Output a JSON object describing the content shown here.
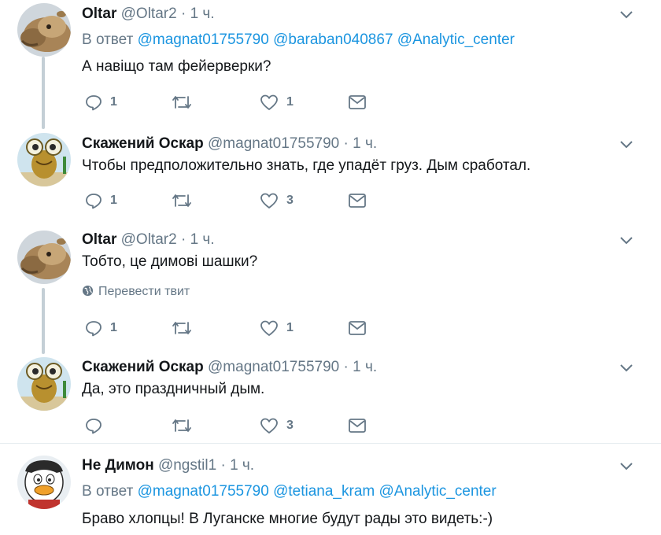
{
  "tweets": [
    {
      "name": "Oltar",
      "handle": "@Oltar2",
      "dot": "·",
      "time": "1 ч.",
      "reply_prefix": "В ответ",
      "mentions": [
        "@magnat01755790",
        "@baraban040867",
        "@Analytic_center"
      ],
      "text": "А навіщо там фейерверки?",
      "replies": "1",
      "retweets": "",
      "likes": "1"
    },
    {
      "name": "Скажений Оскар",
      "handle": "@magnat01755790",
      "dot": "·",
      "time": "1 ч.",
      "text": "Чтобы предположительно знать, где упадёт груз. Дым сработал.",
      "replies": "1",
      "retweets": "",
      "likes": "3"
    },
    {
      "name": "Oltar",
      "handle": "@Oltar2",
      "dot": "·",
      "time": "1 ч.",
      "text": "Тобто, це димові шашки?",
      "translate": "Перевести твит",
      "replies": "1",
      "retweets": "",
      "likes": "1"
    },
    {
      "name": "Скажений Оскар",
      "handle": "@magnat01755790",
      "dot": "·",
      "time": "1 ч.",
      "text": "Да, это праздничный дым.",
      "replies": "",
      "retweets": "",
      "likes": "3"
    },
    {
      "name": "Не Димон",
      "handle": "@ngstil1",
      "dot": "·",
      "time": "1 ч.",
      "reply_prefix": "В ответ",
      "mentions": [
        "@magnat01755790",
        "@tetiana_kram",
        "@Analytic_center"
      ],
      "text": "Браво хлопцы! В Луганске многие будут рады это видеть:-)"
    }
  ],
  "colors": {
    "mention": "#1b95e0",
    "secondary": "#657786",
    "thread_line": "#c4cfd6",
    "divider": "#e6ecf0"
  }
}
